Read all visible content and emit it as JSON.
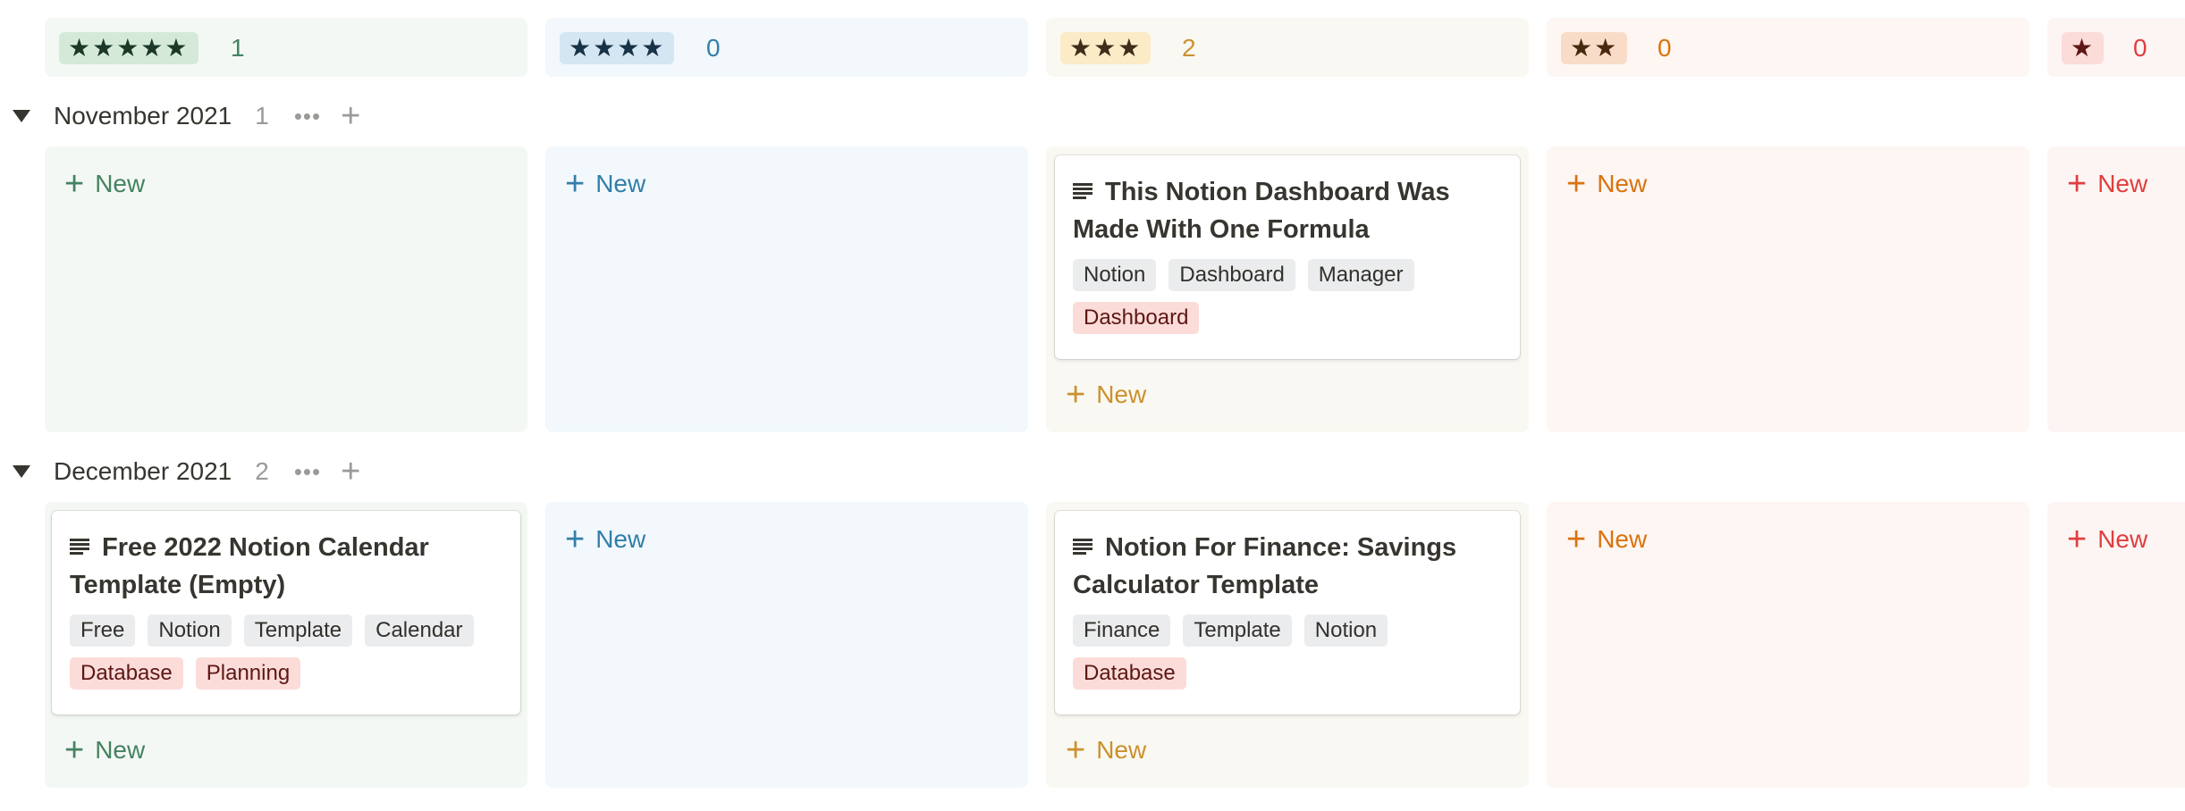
{
  "columns": [
    {
      "stars": "★★★★★",
      "count": "1"
    },
    {
      "stars": "★★★★",
      "count": "0"
    },
    {
      "stars": "★★★",
      "count": "2"
    },
    {
      "stars": "★★",
      "count": "0"
    },
    {
      "stars": "★",
      "count": "0"
    }
  ],
  "new_label": "New",
  "groups": [
    {
      "title": "November 2021",
      "count": "1",
      "cards": [
        {
          "title": "This Notion Dashboard Was Made With One Formula",
          "tags": [
            "Notion",
            "Dashboard",
            "Manager"
          ],
          "red_tags": [
            "Dashboard"
          ]
        }
      ]
    },
    {
      "title": "December 2021",
      "count": "2",
      "cards": [
        {
          "title": "Free 2022 Notion Calendar Template (Empty)",
          "tags": [
            "Free",
            "Notion",
            "Template",
            "Calendar"
          ],
          "red_tags": [
            "Database",
            "Planning"
          ]
        },
        {
          "title": "Notion For Finance: Savings Calculator Template",
          "tags": [
            "Finance",
            "Template",
            "Notion"
          ],
          "red_tags": [
            "Database"
          ]
        }
      ]
    }
  ],
  "icons": {
    "group_toggle": "triangle-down-icon",
    "more": "more-dots-icon",
    "add": "plus-icon",
    "page": "page-lines-icon"
  },
  "colors": {
    "green": "#448361",
    "blue": "#337ea9",
    "yellow": "#cb912f",
    "orange": "#d9730d",
    "red": "#e03e3e",
    "gray_tag": "#ebeced",
    "red_tag": "#fbdcd9"
  }
}
